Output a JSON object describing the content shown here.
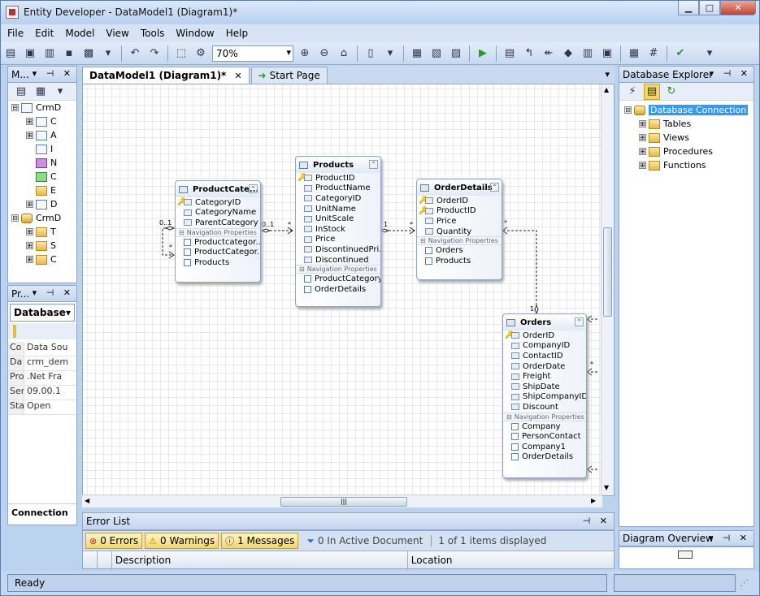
{
  "window": {
    "title": "Entity Developer - DataModel1 (Diagram1)*"
  },
  "menu": [
    "File",
    "Edit",
    "Model",
    "View",
    "Tools",
    "Window",
    "Help"
  ],
  "toolbar": {
    "zoom": "70%"
  },
  "model_explorer": {
    "title": "M...",
    "items": [
      {
        "level": 0,
        "label": "CrmD",
        "exp": "⊟",
        "icon": "tbl"
      },
      {
        "level": 1,
        "label": "C",
        "exp": "⊞",
        "icon": "tbl"
      },
      {
        "level": 1,
        "label": "A",
        "exp": "⊞",
        "icon": "tbl"
      },
      {
        "level": 1,
        "label": "I",
        "exp": "",
        "icon": "tbl"
      },
      {
        "level": 1,
        "label": "N",
        "exp": "",
        "icon": "purple"
      },
      {
        "level": 1,
        "label": "C",
        "exp": "",
        "icon": "green"
      },
      {
        "level": 1,
        "label": "E",
        "exp": "",
        "icon": "fold"
      },
      {
        "level": 1,
        "label": "D",
        "exp": "⊞",
        "icon": "tbl"
      },
      {
        "level": 0,
        "label": "CrmD",
        "exp": "⊟",
        "icon": "db"
      },
      {
        "level": 1,
        "label": "T",
        "exp": "⊞",
        "icon": "fold"
      },
      {
        "level": 1,
        "label": "S",
        "exp": "⊞",
        "icon": "fold"
      },
      {
        "level": 1,
        "label": "C",
        "exp": "⊞",
        "icon": "fold"
      }
    ]
  },
  "properties": {
    "title": "Pr...",
    "selector": "Database",
    "rows": [
      {
        "k": "Co",
        "v": "Data Sou"
      },
      {
        "k": "Da",
        "v": "crm_dem"
      },
      {
        "k": "Pro",
        "v": ".Net Fra"
      },
      {
        "k": "Ser",
        "v": "09.00.1"
      },
      {
        "k": "Sta",
        "v": "Open"
      }
    ],
    "footer": "Connection"
  },
  "tabs": [
    {
      "label": "DataModel1 (Diagram1)*",
      "close": "✕"
    },
    {
      "label": "Start Page"
    }
  ],
  "entities": [
    {
      "id": "productcategory",
      "title": "ProductCate...",
      "props": [
        {
          "n": "CategoryID",
          "key": true
        },
        {
          "n": "CategoryName"
        },
        {
          "n": "ParentCategory"
        }
      ],
      "nav_label": "Navigation Properties",
      "nav": [
        "Productcategor...",
        "ProductCategor...",
        "Products"
      ]
    },
    {
      "id": "products",
      "title": "Products",
      "props": [
        {
          "n": "ProductID",
          "key": true
        },
        {
          "n": "ProductName"
        },
        {
          "n": "CategoryID"
        },
        {
          "n": "UnitName"
        },
        {
          "n": "UnitScale"
        },
        {
          "n": "InStock"
        },
        {
          "n": "Price"
        },
        {
          "n": "DiscontinuedPri..."
        },
        {
          "n": "Discontinued"
        }
      ],
      "nav_label": "Navigation Properties",
      "nav": [
        "ProductCategory",
        "OrderDetails"
      ]
    },
    {
      "id": "orderdetails",
      "title": "OrderDetails",
      "props": [
        {
          "n": "OrderID",
          "key": true
        },
        {
          "n": "ProductID",
          "key": true
        },
        {
          "n": "Price"
        },
        {
          "n": "Quantity"
        }
      ],
      "nav_label": "Navigation Properties",
      "nav": [
        "Orders",
        "Products"
      ]
    },
    {
      "id": "orders",
      "title": "Orders",
      "props": [
        {
          "n": "OrderID",
          "key": true
        },
        {
          "n": "CompanyID"
        },
        {
          "n": "ContactID"
        },
        {
          "n": "OrderDate"
        },
        {
          "n": "Freight"
        },
        {
          "n": "ShipDate"
        },
        {
          "n": "ShipCompanyID"
        },
        {
          "n": "Discount"
        }
      ],
      "nav_label": "Navigation Properties",
      "nav": [
        "Company",
        "PersonContact",
        "Company1",
        "OrderDetails"
      ]
    }
  ],
  "multiplicities": {
    "m1": "0..1",
    "m2": "*",
    "m3": "0..1",
    "m4": "*",
    "m5": "1",
    "m6": "*",
    "m7": "*",
    "m8": "1",
    "m9": "*"
  },
  "error_list": {
    "title": "Error List",
    "errors": "0 Errors",
    "warnings": "0 Warnings",
    "messages": "1 Messages",
    "active_doc": "0 In Active Document",
    "displayed": "1 of 1 items displayed",
    "col_description": "Description",
    "col_location": "Location"
  },
  "database_explorer": {
    "title": "Database Explorer",
    "root": "Database Connection",
    "children": [
      "Tables",
      "Views",
      "Procedures",
      "Functions"
    ]
  },
  "diagram_overview": {
    "title": "Diagram Overview"
  },
  "status": {
    "text": "Ready"
  }
}
